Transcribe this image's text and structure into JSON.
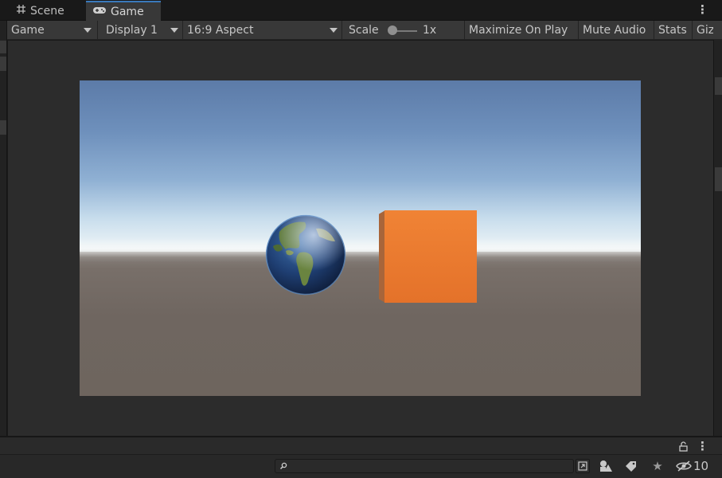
{
  "tabs": [
    {
      "label": "Scene",
      "icon": "grid-icon",
      "active": false
    },
    {
      "label": "Game",
      "icon": "gamepad-icon",
      "active": true
    }
  ],
  "toolbar": {
    "mode": "Game",
    "display": "Display 1",
    "aspect": "16:9 Aspect",
    "scale_label": "Scale",
    "scale_value": "1x",
    "maximize": "Maximize On Play",
    "mute": "Mute Audio",
    "stats": "Stats",
    "gizmos": "Gizmos"
  },
  "colors": {
    "tab_highlight": "#3a79bb",
    "cube": "#e8762d",
    "sky": "#6b8db8",
    "ground": "#71675f"
  },
  "scene": {
    "objects": [
      "earth-sphere",
      "orange-cube"
    ]
  },
  "statusbar": {
    "search_placeholder": "",
    "hidden_count": "10",
    "icons": [
      "lock-icon",
      "more-icon",
      "search-icon",
      "scene-visibility-icon",
      "shapes-icon",
      "tag-icon",
      "star-icon",
      "eye-hidden-icon"
    ]
  }
}
